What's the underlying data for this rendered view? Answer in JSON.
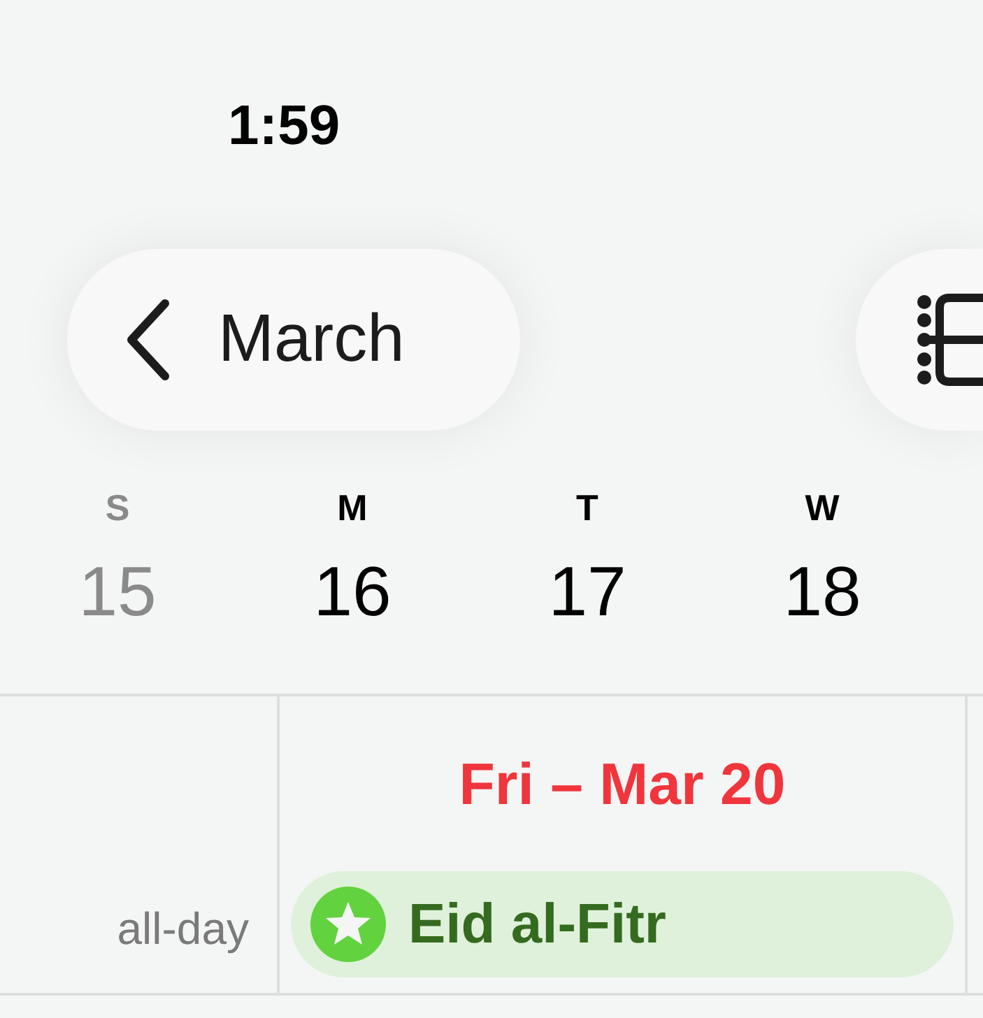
{
  "status_bar": {
    "time": "1:59"
  },
  "nav": {
    "back_label": "March"
  },
  "week": [
    {
      "letter": "S",
      "day": "15",
      "dimmed": true
    },
    {
      "letter": "M",
      "day": "16",
      "dimmed": false
    },
    {
      "letter": "T",
      "day": "17",
      "dimmed": false
    },
    {
      "letter": "W",
      "day": "18",
      "dimmed": false
    }
  ],
  "day_view": {
    "date_heading": "Fri – Mar 20",
    "all_day_label": "all-day",
    "events": [
      {
        "title": "Eid al-Fitr",
        "color": "#63d23f"
      }
    ]
  }
}
